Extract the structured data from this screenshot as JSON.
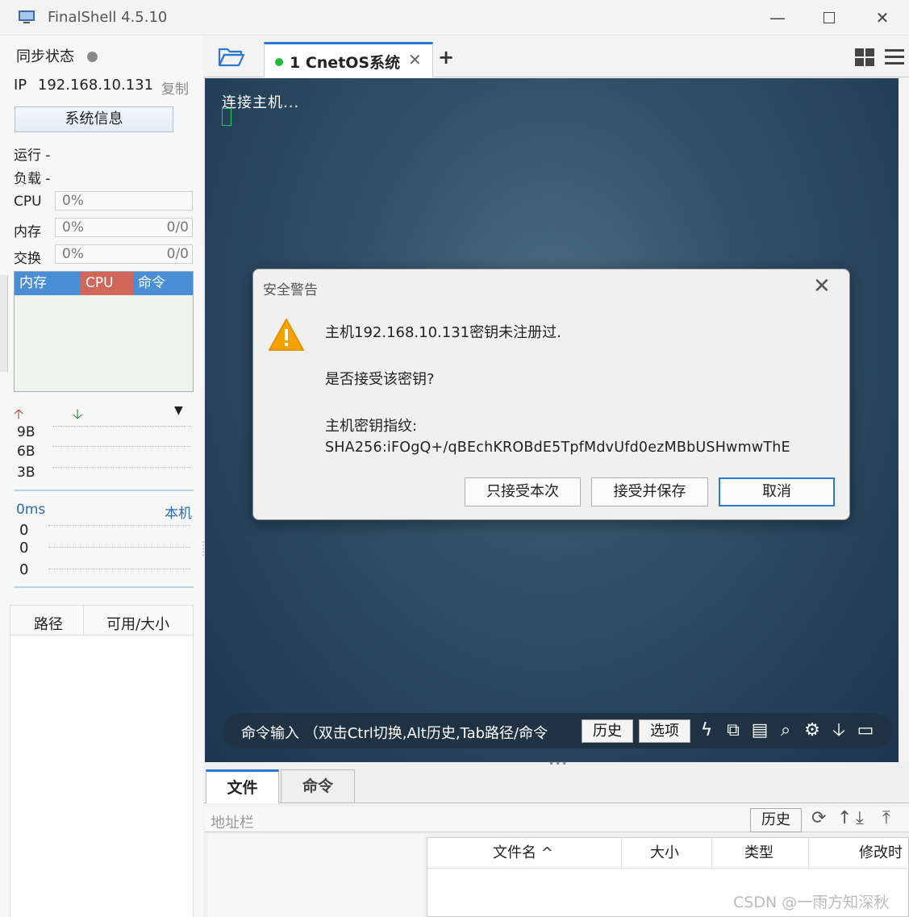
{
  "window": {
    "title": "FinalShell 4.5.10"
  },
  "sidebar": {
    "sync_status": "同步状态",
    "ip_label": "IP",
    "ip_value": "192.168.10.131",
    "copy_label": "复制",
    "sysinfo_button": "系统信息",
    "run_label": "运行 -",
    "load_label": "负载 -",
    "cpu": {
      "label": "CPU",
      "value": "0%"
    },
    "memory": {
      "label": "内存",
      "value": "0%",
      "detail": "0/0"
    },
    "swap": {
      "label": "交换",
      "value": "0%",
      "detail": "0/0"
    },
    "process_columns": [
      "内存",
      "CPU",
      "命令"
    ],
    "net_levels": [
      "9B",
      "6B",
      "3B"
    ],
    "ping": {
      "value": "0ms",
      "target": "本机",
      "rows": [
        "0",
        "0",
        "0"
      ]
    },
    "disk_columns": [
      "路径",
      "可用/大小"
    ]
  },
  "tabs": {
    "session": {
      "number": "1",
      "name": "CnetOS系统",
      "label": "1 CnetOS系统"
    }
  },
  "terminal": {
    "line": "连接主机..."
  },
  "command_bar": {
    "hint": "命令输入 （双击Ctrl切换,Alt历史,Tab路径/命令",
    "history_button": "历史",
    "options_button": "选项"
  },
  "dialog": {
    "title": "安全警告",
    "message": "主机192.168.10.131密钥未注册过.",
    "question": "是否接受该密钥?",
    "fingerprint_label": "主机密钥指纹:",
    "fingerprint": "SHA256:iFOgQ+/qBEchKROBdE5TpfMdvUfd0ezMBbUSHwmwThE",
    "buttons": {
      "accept_once": "只接受本次",
      "accept_save": "接受并保存",
      "cancel": "取消"
    }
  },
  "file_panel": {
    "tabs": [
      "文件",
      "命令"
    ],
    "address_placeholder": "地址栏",
    "history_button": "历史",
    "columns": [
      "文件名 ^",
      "大小",
      "类型",
      "修改时"
    ]
  },
  "watermark": "CSDN @一雨方知深秋",
  "colors": {
    "accent": "#2b78d4",
    "mem_col": "#4a8fd6",
    "cpu_col": "#d0675a",
    "warning": "#f5a300",
    "connected": "#22bb33"
  }
}
